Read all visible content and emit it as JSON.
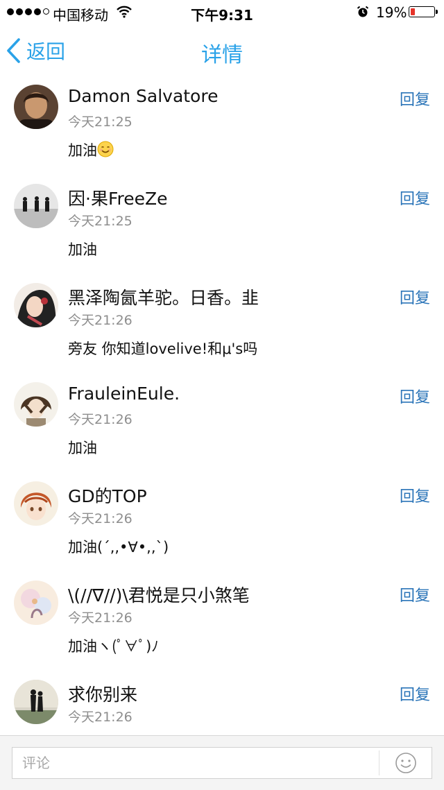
{
  "status_bar": {
    "carrier": "中国移动",
    "time": "下午9:31",
    "battery_percent": "19%",
    "battery_level": 0.19,
    "battery_color": "#e5332a",
    "signal_dots": 5,
    "signal_filled": 4
  },
  "nav": {
    "back_label": "返回",
    "title": "详情",
    "accent_color": "#2aa2e8"
  },
  "comments": [
    {
      "username": "Damon Salvatore",
      "time": "今天21:25",
      "content": "加油",
      "emoji": "smile",
      "reply_label": "回复"
    },
    {
      "username": "因·果FreeZe",
      "time": "今天21:25",
      "content": "加油",
      "reply_label": "回复"
    },
    {
      "username": "黑泽陶氤羊驼。日香。韭",
      "time": "今天21:26",
      "content": "旁友 你知道lovelive!和μ's吗",
      "reply_label": "回复"
    },
    {
      "username": "FrauleinEule.",
      "time": "今天21:26",
      "content": "加油",
      "reply_label": "回复"
    },
    {
      "username": "GD的TOP",
      "time": "今天21:26",
      "content": "加油(´,,•∀•,,`)",
      "reply_label": "回复"
    },
    {
      "username": "\\(//∇//)\\君悦是只小煞笔",
      "time": "今天21:26",
      "content": "加油ヽ(ﾟ∀ﾟ)ﾉ",
      "reply_label": "回复"
    },
    {
      "username": "求你别来",
      "time": "今天21:26",
      "content": "",
      "reply_label": "回复"
    }
  ],
  "comment_bar": {
    "placeholder": "评论",
    "emoji_icon": "smiley-face-icon"
  }
}
